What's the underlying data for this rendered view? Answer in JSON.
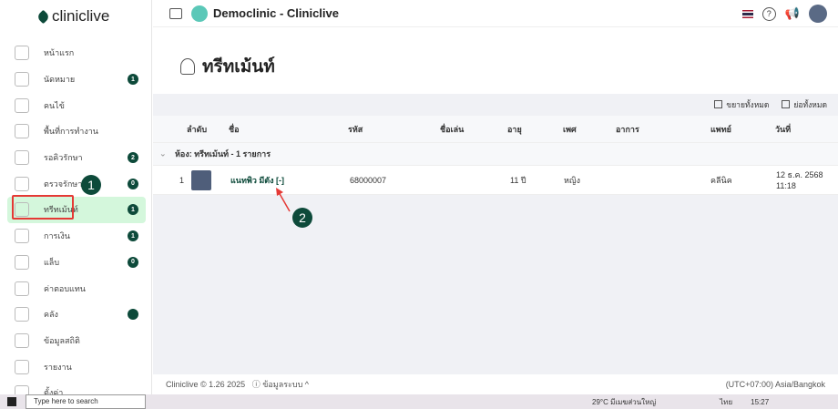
{
  "app": {
    "logo": "cliniclive",
    "title": "Democlinic - Cliniclive"
  },
  "sidebar": {
    "items": [
      {
        "label": "หน้าแรก",
        "badge": null
      },
      {
        "label": "นัดหมาย",
        "badge": "1"
      },
      {
        "label": "คนไข้",
        "badge": null
      },
      {
        "label": "พื้นที่การทำงาน",
        "badge": null
      },
      {
        "label": "รอคิวรักษา",
        "badge": "2"
      },
      {
        "label": "ตรวจรักษา",
        "badge": "0"
      },
      {
        "label": "ทรีทเม้นท์",
        "badge": "1",
        "active": true
      },
      {
        "label": "การเงิน",
        "badge": "1"
      },
      {
        "label": "แล็บ",
        "badge": "0"
      },
      {
        "label": "ค่าตอบแทน",
        "badge": null
      },
      {
        "label": "คลัง",
        "badge": ""
      },
      {
        "label": "ข้อมูลสถิติ",
        "badge": null
      },
      {
        "label": "รายงาน",
        "badge": null
      },
      {
        "label": "ตั้งค่า",
        "badge": null
      }
    ]
  },
  "page": {
    "title": "ทรีทเม้นท์"
  },
  "toolbar": {
    "expand_all": "ขยายทั้งหมด",
    "collapse_all": "ย่อทั้งหมด"
  },
  "table": {
    "columns": [
      "ลำดับ",
      "ชื่อ",
      "รหัส",
      "ชื่อเล่น",
      "อายุ",
      "เพศ",
      "อาการ",
      "แพทย์",
      "วันที่"
    ],
    "group": "ห้อง: ทรีทเม้นท์ - 1 รายการ",
    "rows": [
      {
        "no": "1",
        "name": "แนทพิว มีตัง [-]",
        "code": "68000007",
        "nickname": "",
        "age": "11 ปี",
        "sex": "หญิง",
        "symptom": "",
        "doctor": "คลีนิค",
        "date": "12 ธ.ค. 2568",
        "time": "11:18"
      }
    ]
  },
  "annotations": {
    "marker1": "1",
    "marker2": "2"
  },
  "footer": {
    "version": "Cliniclive © 1.26 2025",
    "info": "ⓘ ข้อมูลระบบ ^",
    "timezone": "(UTC+07:00) Asia/Bangkok"
  },
  "taskbar": {
    "search_placeholder": "Type here to search",
    "weather": "29°C มีเมฆส่วนใหญ่",
    "lang": "ไทย",
    "time": "15:27"
  },
  "colors": {
    "brand": "#0d4a3a",
    "active_bg": "#d4f7dc",
    "annotation": "#e53935"
  }
}
